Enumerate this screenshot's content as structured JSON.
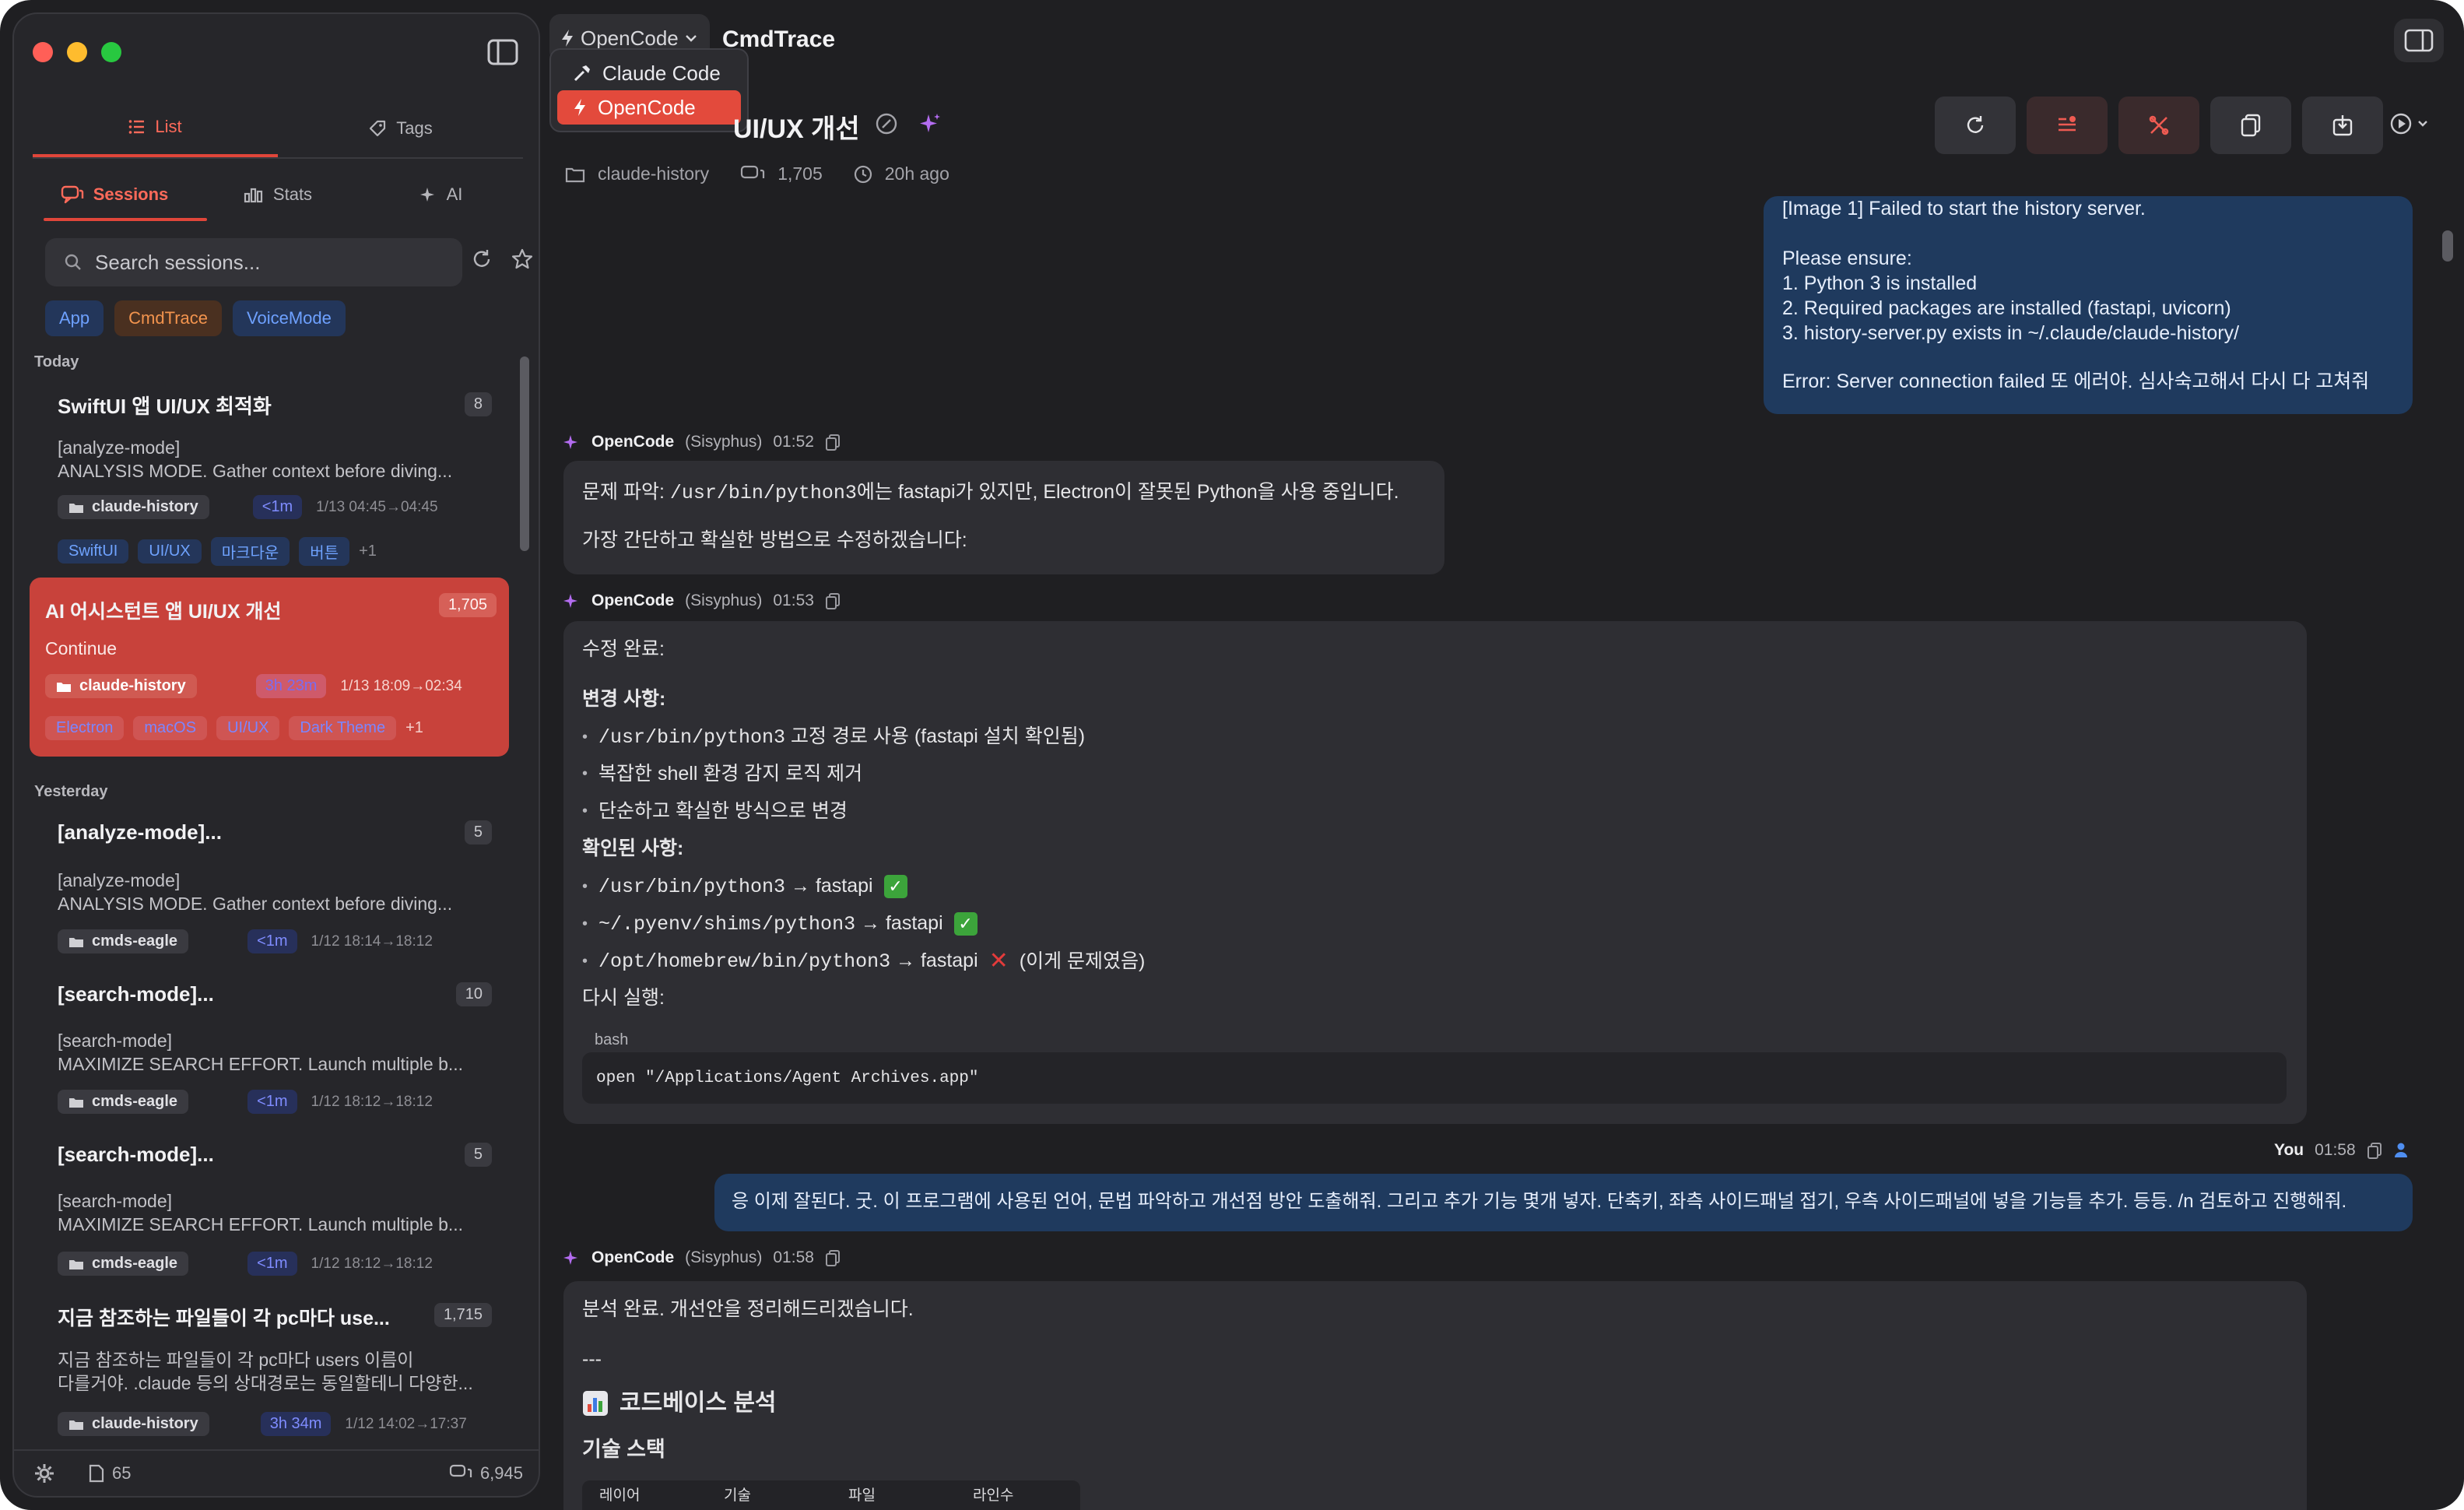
{
  "sidebar": {
    "topnav": [
      {
        "label": "List"
      },
      {
        "label": "Tags"
      }
    ],
    "subnav": [
      {
        "label": "Sessions"
      },
      {
        "label": "Stats"
      },
      {
        "label": "AI"
      }
    ],
    "search_placeholder": "Search sessions...",
    "filters": [
      {
        "label": "App",
        "color": "blue"
      },
      {
        "label": "CmdTrace",
        "color": "orange"
      },
      {
        "label": "VoiceMode",
        "color": "blue"
      }
    ],
    "groups": {
      "today": "Today",
      "yesterday": "Yesterday"
    },
    "sessions": [
      {
        "title": "SwiftUI 앱 UI/UX 최적화",
        "count": "8",
        "preview1": "[analyze-mode]",
        "preview2": "ANALYSIS MODE. Gather context before diving...",
        "folder": "claude-history",
        "duration": "<1m",
        "time": "1/13 04:45→04:45",
        "tags": [
          "SwiftUI",
          "UI/UX",
          "마크다운",
          "버튼"
        ],
        "more": "+1"
      },
      {
        "title": "AI 어시스턴트 앱 UI/UX 개선",
        "count": "1,705",
        "preview1": "Continue",
        "folder": "claude-history",
        "duration": "3h 23m",
        "time": "1/13 18:09→02:34",
        "tags": [
          "Electron",
          "macOS",
          "UI/UX",
          "Dark Theme"
        ],
        "more": "+1"
      },
      {
        "title": "[analyze-mode]...",
        "count": "5",
        "preview1": "[analyze-mode]",
        "preview2": "ANALYSIS MODE. Gather context before diving...",
        "folder": "cmds-eagle",
        "duration": "<1m",
        "time": "1/12 18:14→18:12"
      },
      {
        "title": "[search-mode]...",
        "count": "10",
        "preview1": "[search-mode]",
        "preview2": "MAXIMIZE SEARCH EFFORT. Launch multiple b...",
        "folder": "cmds-eagle",
        "duration": "<1m",
        "time": "1/12 18:12→18:12"
      },
      {
        "title": "[search-mode]...",
        "count": "5",
        "preview1": "[search-mode]",
        "preview2": "MAXIMIZE SEARCH EFFORT. Launch multiple b...",
        "folder": "cmds-eagle",
        "duration": "<1m",
        "time": "1/12 18:12→18:12"
      },
      {
        "title": "지금 참조하는 파일들이 각 pc마다 use...",
        "count": "1,715",
        "preview1": "지금 참조하는 파일들이 각 pc마다 users 이름이",
        "preview2": "다를거야. .claude 등의 상대경로는 동일할테니 다양한...",
        "folder": "claude-history",
        "duration": "3h 34m",
        "time": "1/12 14:02→17:37"
      }
    ],
    "footer": {
      "files": "65",
      "messages": "6,945"
    }
  },
  "header": {
    "picker_label": "OpenCode",
    "app_name": "CmdTrace",
    "dropdown": [
      {
        "label": "Claude Code"
      },
      {
        "label": "OpenCode"
      }
    ],
    "title_visible": "UI/UX 개선",
    "folder": "claude-history",
    "message_count": "1,705",
    "updated": "20h ago"
  },
  "chat": {
    "user1": {
      "line1": "[Image 1] Failed to start the history server.",
      "line2": "Please ensure:",
      "line3": "1. Python 3 is installed",
      "line4": "2. Required packages are installed (fastapi, uvicorn)",
      "line5": "3. history-server.py exists in ~/.claude/claude-history/",
      "line6": "Error: Server connection failed  또 에러야. 심사숙고해서 다시 다 고쳐줘"
    },
    "ai1": {
      "name": "OpenCode",
      "agent": "(Sisyphus)",
      "time": "01:52",
      "line1_pre": "문제 파악: ",
      "line1_code": "/usr/bin/python3",
      "line1_post": "에는 fastapi가 있지만, Electron이 잘못된 Python을 사용 중입니다.",
      "line2": "가장 간단하고 확실한 방법으로 수정하겠습니다:"
    },
    "ai2": {
      "name": "OpenCode",
      "agent": "(Sisyphus)",
      "time": "01:53",
      "done": "수정 완료:",
      "changes_head": "변경 사항:",
      "c1_code": "/usr/bin/python3",
      "c1_text": " 고정 경로 사용 (fastapi 설치 확인됨)",
      "c2": "복잡한 shell 환경 감지 로직 제거",
      "c3": "단순하고 확실한 방식으로 변경",
      "verified_head": "확인된 사항:",
      "v1_code": "/usr/bin/python3",
      "v1_text": " → fastapi",
      "v2_code": "~/.pyenv/shims/python3",
      "v2_text": " → fastapi",
      "v3_code": "/opt/homebrew/bin/python3",
      "v3_text": " → fastapi",
      "v3_note": "(이게 문제였음)",
      "rerun_head": "다시 실행:",
      "lang": "bash",
      "code": "open \"/Applications/Agent Archives.app\""
    },
    "user2": {
      "name": "You",
      "time": "01:58",
      "text": "응 이제 잘된다. 굿. 이 프로그램에 사용된 언어, 문법 파악하고 개선점 방안 도출해줘. 그리고 추가 기능 몇개 넣자. 단축키, 좌측 사이드패널 접기, 우측 사이드패널에 넣을 기능들 추가. 등등. /n 검토하고 진행해줘."
    },
    "ai3": {
      "name": "OpenCode",
      "agent": "(Sisyphus)",
      "time": "01:58",
      "line1": "분석 완료. 개선안을 정리해드리겠습니다.",
      "sep": "---",
      "h2": "코드베이스 분석",
      "h3": "기술 스택",
      "table_headers": [
        "레이어",
        "기술",
        "파일",
        "라인수"
      ]
    }
  },
  "colors": {
    "accent": "#e0463a",
    "selected_card": "#c8423b",
    "user_bubble": "#1f3a5e",
    "blue_chip": "#6ea1ff",
    "orange_chip": "#f3944e"
  }
}
